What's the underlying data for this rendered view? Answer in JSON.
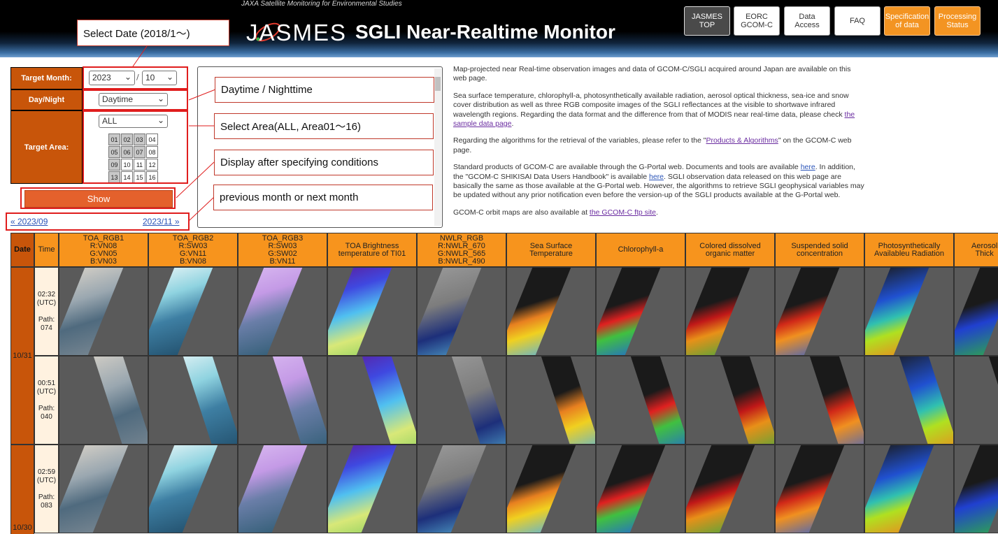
{
  "header": {
    "tagline": "JAXA Satellite Monitoring for Environmental Studies",
    "logo": "JASMES",
    "title": "SGLI Near-Realtime Monitor",
    "nav": [
      {
        "label": "JASMES\nTOP",
        "style": "gray"
      },
      {
        "label": "EORC\nGCOM-C",
        "style": "white"
      },
      {
        "label": "Data\nAccess",
        "style": "white"
      },
      {
        "label": "FAQ",
        "style": "white"
      },
      {
        "label": "Specification\nof data",
        "style": "orange"
      },
      {
        "label": "Processing\nStatus",
        "style": "orange"
      }
    ]
  },
  "form": {
    "target_month_label": "Target Month:",
    "year_value": "2023",
    "month_separator": "/",
    "month_value": "10",
    "day_night_label": "Day/Night",
    "day_night_value": "Daytime",
    "target_area_label": "Target Area:",
    "area_value": "ALL",
    "area_cells": [
      "01",
      "02",
      "03",
      "04",
      "05",
      "06",
      "07",
      "08",
      "09",
      "10",
      "11",
      "12",
      "13",
      "14",
      "15",
      "16"
    ],
    "show_label": "Show",
    "prev_month": "« 2023/09",
    "next_month": "2023/11 »"
  },
  "annotations": {
    "select_date": "Select Date (2018/1～)",
    "day_night": "Daytime / Nighttime",
    "select_area": "Select Area(ALL, Area01～16)",
    "display": "Display after specifying conditions",
    "prev_next": "previous month or next month"
  },
  "description": {
    "p1": "Map-projected near Real-time observation images and data of GCOM-C/SGLI acquired around Japan are available on this web page.",
    "p2_a": "Sea surface temperature, chlorophyll-a, photosynthetically available radiation, aerosol optical thickness, sea-ice and snow cover distribution as well as three RGB composite images of the SGLI reflectances at the visible to shortwave infrared wavelength regions. Regarding the data format and the difference from that of MODIS near real-time data, please check ",
    "p2_link": "the sample data page",
    "p2_b": ".",
    "p3_a": "Regarding the algorithms for the retrieval of the variables, please refer to the \"",
    "p3_link": "Products & Algorithms",
    "p3_b": "\" on the GCOM-C web page.",
    "p4_a": "Standard products of GCOM-C are available through the G-Portal web. Documents and tools are available ",
    "p4_link1": "here",
    "p4_b": ". In addition, the \"GCOM-C SHIKISAI Data Users Handbook\" is available ",
    "p4_link2": "here",
    "p4_c": ". SGLI observation data released on this web page are basically the same as those available at the G-Portal web. However, the algorithms to retrieve SGLI geophysical variables may be updated without any prior notification even before the version-up of the SGLI products available at the G-Portal web.",
    "p5_a": "GCOM-C orbit maps are also available at ",
    "p5_link": "the GCOM-C ftp site",
    "p5_b": "."
  },
  "table": {
    "date_header": "Date",
    "time_header": "Time",
    "columns": [
      "TOA_RGB1\nR:VN08\nG:VN05\nB:VN03",
      "TOA_RGB2\nR:SW03\nG:VN11\nB:VN08",
      "TOA_RGB3\nR:SW03\nG:SW02\nB:VN11",
      "TOA Brightness\ntemperature of TI01",
      "NWLR_RGB\nR:NWLR_670\nG:NWLR_565\nB:NWLR_490",
      "Sea Surface\nTemperature",
      "Chlorophyll-a",
      "Colored dissolved\norganic matter",
      "Suspended solid\nconcentration",
      "Photosynthetically\nAvailableu Radiation",
      "Aerosol\nThick"
    ],
    "dates": [
      "10/31",
      "10/30"
    ],
    "rows": [
      {
        "time": "02:32\n(UTC)\n\nPath:\n074"
      },
      {
        "time": "00:51\n(UTC)\n\nPath:\n040"
      },
      {
        "time": "02:59\n(UTC)\n\nPath:\n083"
      }
    ]
  },
  "colors": {
    "header_orange": "#f7941d",
    "date_orange": "#c8550a",
    "annotation_red": "#e01d1d",
    "show_button": "#e4612c"
  }
}
